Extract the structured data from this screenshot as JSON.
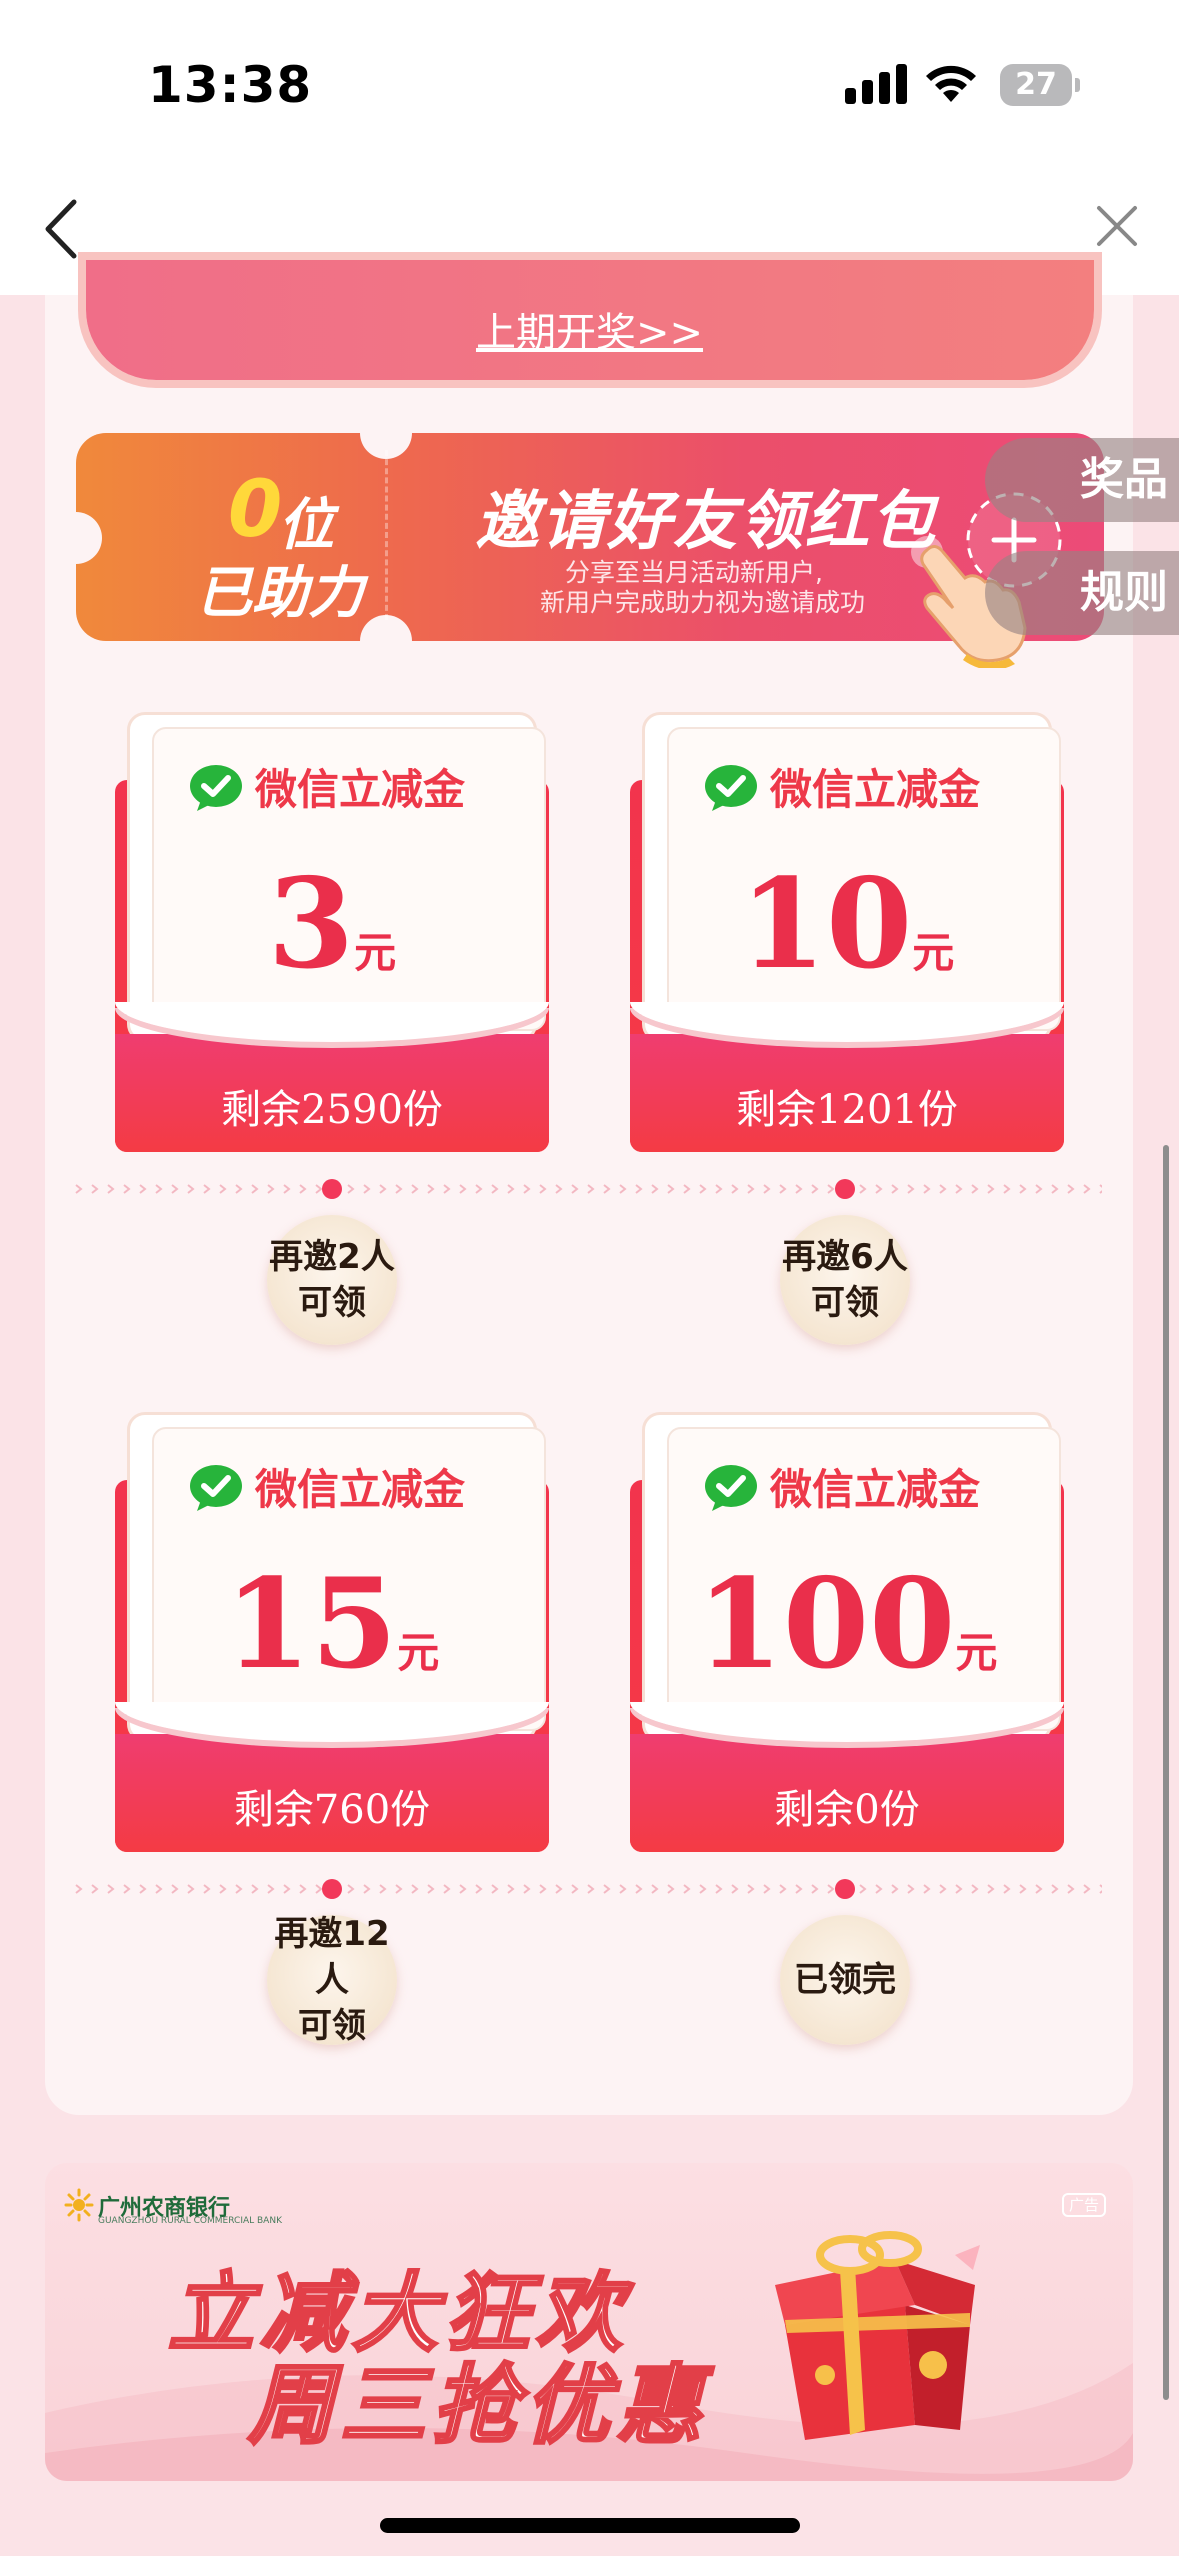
{
  "status_bar": {
    "time": "13:38",
    "battery": "27"
  },
  "nav": {
    "back_icon": "chevron-left-icon",
    "close_icon": "close-icon"
  },
  "prev_draw": {
    "link": "上期开奖>>"
  },
  "invite": {
    "count": "0",
    "count_unit": "位",
    "helped_label": "已助力",
    "title": "邀请好友领红包",
    "subtitle_line1": "分享至当月活动新用户,",
    "subtitle_line2": "新用户完成助力视为邀请成功"
  },
  "side_tabs": {
    "prizes": "奖品",
    "rules": "规则"
  },
  "colors": {
    "accent_red": "#ee3849",
    "bg_pink": "#fbe3e7",
    "wechat_green": "#27b43b"
  },
  "cards": [
    {
      "brand": "微信立减金",
      "amount": "3",
      "unit": "元",
      "remaining": "剩余2590份",
      "status_line1": "再邀2人",
      "status_line2": "可领"
    },
    {
      "brand": "微信立减金",
      "amount": "10",
      "unit": "元",
      "remaining": "剩余1201份",
      "status_line1": "再邀6人",
      "status_line2": "可领"
    },
    {
      "brand": "微信立减金",
      "amount": "15",
      "unit": "元",
      "remaining": "剩余760份",
      "status_line1": "再邀12人",
      "status_line2": "可领"
    },
    {
      "brand": "微信立减金",
      "amount": "100",
      "unit": "元",
      "remaining": "剩余0份",
      "status_line1": "已领完",
      "status_line2": ""
    }
  ],
  "ad": {
    "logo_text": "广州农商银行",
    "logo_sub": "GUANGZHOU RURAL COMMERCIAL BANK",
    "tag": "广告",
    "line1": "立减大狂欢",
    "line2": "周三抢优惠"
  }
}
